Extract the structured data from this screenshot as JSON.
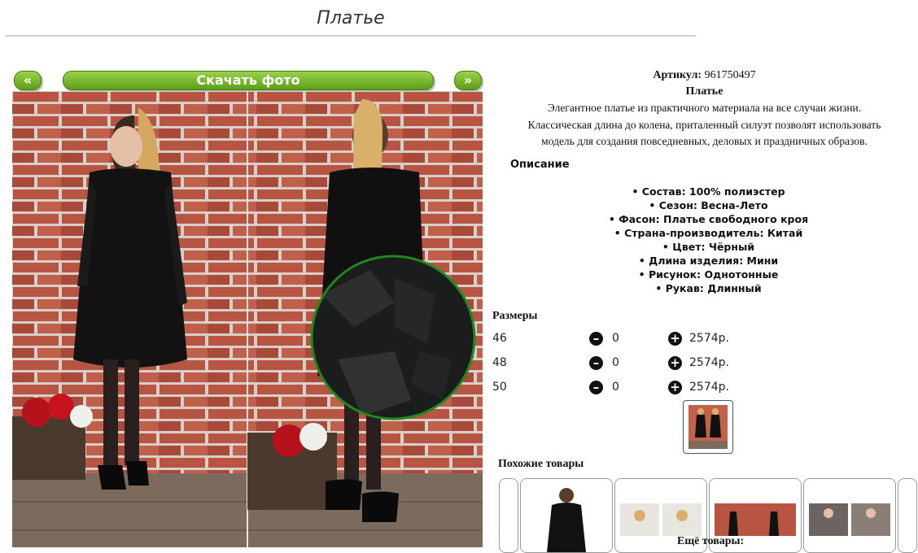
{
  "page": {
    "title": "Платье"
  },
  "photo_nav": {
    "prev": "«",
    "download": "Скачать фото",
    "next": "»"
  },
  "product": {
    "sku_label": "Артикул:",
    "sku_value": "961750497",
    "name": "Платье",
    "description_lines": [
      "Элегантное платье из практичного материала на все случаи жизни.",
      "Классическая длина до колена, приталенный силуэт позволят использовать",
      "модель для создания повседневных, деловых и праздничных образов."
    ],
    "description_heading": "Описание",
    "specs": [
      "• Состав: 100% полиэстер",
      "• Сезон: Весна-Лето",
      "• Фасон: Платье свободного кроя",
      "• Страна-производитель: Китай",
      "• Цвет: Чёрный",
      "• Длина изделия: Мини",
      "• Рисунок: Однотонные",
      "• Рукав: Длинный"
    ]
  },
  "sizes": {
    "heading": "Размеры",
    "rows": [
      {
        "size": "46",
        "qty": "0",
        "price": "2574р."
      },
      {
        "size": "48",
        "qty": "0",
        "price": "2574р."
      },
      {
        "size": "50",
        "qty": "0",
        "price": "2574р."
      }
    ]
  },
  "similar": {
    "heading": "Похожие товары",
    "more": "Ещё товары:"
  },
  "colors": {
    "green_button": "#6fb02a",
    "zoom_ring": "#1c8a1c",
    "thumb_border": "#3a5a86"
  },
  "icons": {
    "minus": "minus-circle-icon",
    "plus": "plus-circle-icon"
  }
}
